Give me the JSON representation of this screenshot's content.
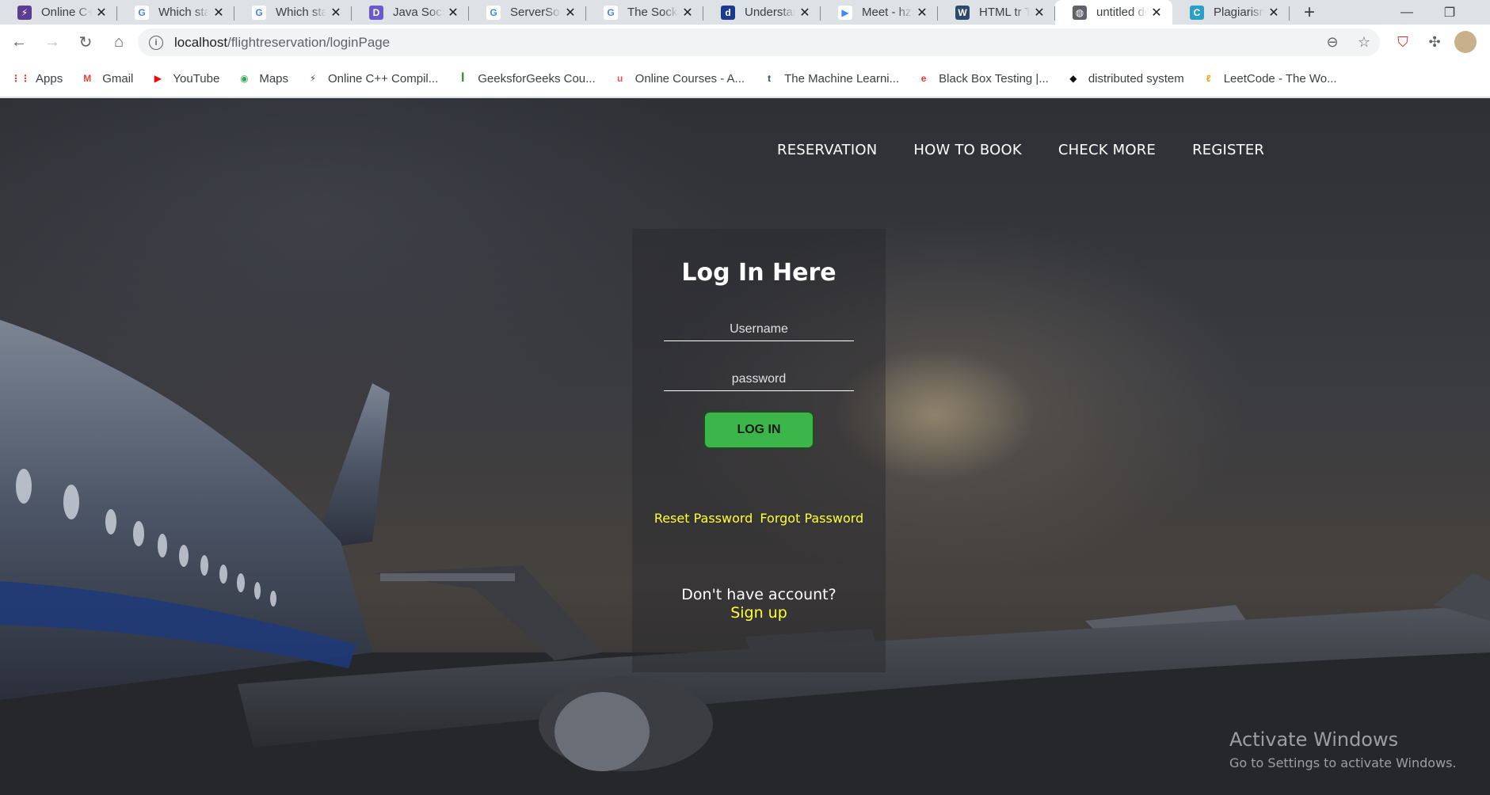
{
  "browser": {
    "tabs": [
      {
        "title": "Online C++ Compiler",
        "fav_color": "#5b3e8f",
        "fav_glyph": "⚡",
        "active": false
      },
      {
        "title": "Which statement",
        "fav_color": "#ffffff",
        "fav_glyph": "G",
        "active": false
      },
      {
        "title": "Which statement",
        "fav_color": "#ffffff",
        "fav_glyph": "G",
        "active": false
      },
      {
        "title": "Java Socket",
        "fav_color": "#6a5acd",
        "fav_glyph": "D",
        "active": false
      },
      {
        "title": "ServerSocket",
        "fav_color": "#ffffff",
        "fav_glyph": "G",
        "active": false
      },
      {
        "title": "The Socket",
        "fav_color": "#ffffff",
        "fav_glyph": "G",
        "active": false
      },
      {
        "title": "Understanding",
        "fav_color": "#1a3a8f",
        "fav_glyph": "d",
        "active": false
      },
      {
        "title": "Meet - hzy",
        "fav_color": "#ffffff",
        "fav_glyph": "▶",
        "active": false
      },
      {
        "title": "HTML tr Tag",
        "fav_color": "#2e4a6b",
        "fav_glyph": "W",
        "active": false
      },
      {
        "title": "untitled document",
        "fav_color": "#5f6368",
        "fav_glyph": "◍",
        "active": true
      },
      {
        "title": "Plagiarism",
        "fav_color": "#2aa0c8",
        "fav_glyph": "C",
        "active": false
      }
    ],
    "url_host": "localhost",
    "url_path": "/flightreservation/loginPage",
    "bookmarks": [
      {
        "label": "Apps",
        "icon": "apps-grid-icon",
        "color": "#ea4335",
        "glyph": "⋮⋮"
      },
      {
        "label": "Gmail",
        "icon": "gmail-icon",
        "color": "#ea4335",
        "glyph": "M"
      },
      {
        "label": "YouTube",
        "icon": "youtube-icon",
        "color": "#ff0000",
        "glyph": "▶"
      },
      {
        "label": "Maps",
        "icon": "maps-icon",
        "color": "#34a853",
        "glyph": "◉"
      },
      {
        "label": "Online C++ Compil...",
        "icon": "bolt-icon",
        "color": "#5b3e8f",
        "glyph": "⚡"
      },
      {
        "label": "GeeksforGeeks Cou...",
        "icon": "gfg-icon",
        "color": "#2f8d46",
        "glyph": "ꟾ"
      },
      {
        "label": "Online Courses - A...",
        "icon": "udemy-icon",
        "color": "#ec5252",
        "glyph": "u"
      },
      {
        "label": "The Machine Learni...",
        "icon": "tds-icon",
        "color": "#355071",
        "glyph": "t"
      },
      {
        "label": "Black Box Testing |...",
        "icon": "guru-icon",
        "color": "#e0382f",
        "glyph": "e"
      },
      {
        "label": "distributed system",
        "icon": "code-icon",
        "color": "#111111",
        "glyph": "◆"
      },
      {
        "label": "LeetCode - The Wo...",
        "icon": "leetcode-icon",
        "color": "#f89f1b",
        "glyph": "ℓ"
      }
    ]
  },
  "nav": {
    "reservation": "RESERVATION",
    "how_to_book": "HOW TO BOOK",
    "check_more": "CHECK MORE",
    "register": "REGISTER"
  },
  "login": {
    "title": "Log In Here",
    "username_placeholder": "Username",
    "password_placeholder": "password",
    "button": "LOG IN",
    "reset_password": "Reset Password",
    "forgot_password": "Forgot Password",
    "no_account": "Don't have account?",
    "sign_up": "Sign up"
  },
  "watermark": {
    "line1": "Activate Windows",
    "line2": "Go to Settings to activate Windows."
  }
}
